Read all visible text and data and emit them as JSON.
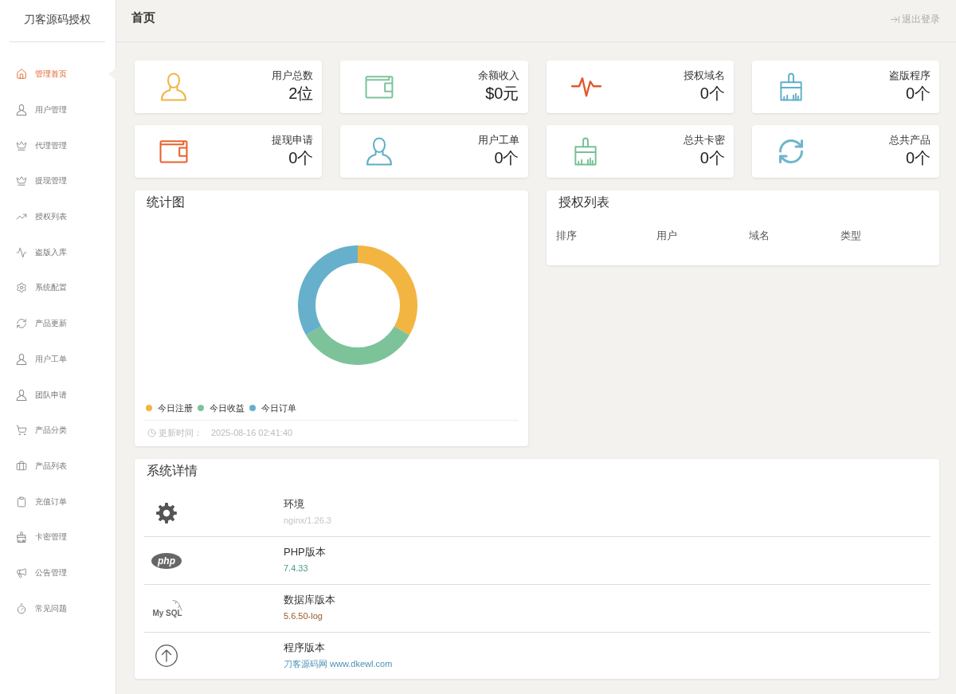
{
  "sidebar": {
    "brand": "刀客源码授权",
    "items": [
      {
        "label": "管理首页",
        "kind": "home",
        "selected": true
      },
      {
        "label": "用户管理",
        "kind": "user",
        "selected": false
      },
      {
        "label": "代理管理",
        "kind": "crown",
        "selected": false
      },
      {
        "label": "提现管理",
        "kind": "crown",
        "selected": false
      },
      {
        "label": "授权列表",
        "kind": "trend",
        "selected": false
      },
      {
        "label": "盗版入库",
        "kind": "pulse",
        "selected": false
      },
      {
        "label": "系统配置",
        "kind": "gear",
        "selected": false
      },
      {
        "label": "产品更新",
        "kind": "refresh",
        "selected": false
      },
      {
        "label": "用户工单",
        "kind": "user",
        "selected": false
      },
      {
        "label": "团队申请",
        "kind": "user",
        "selected": false
      },
      {
        "label": "产品分类",
        "kind": "cart",
        "selected": false
      },
      {
        "label": "产品列表",
        "kind": "bag",
        "selected": false
      },
      {
        "label": "充值订单",
        "kind": "clipboard",
        "selected": false
      },
      {
        "label": "卡密管理",
        "kind": "broom",
        "selected": false
      },
      {
        "label": "公告管理",
        "kind": "megaphone",
        "selected": false
      },
      {
        "label": "常见问题",
        "kind": "timer",
        "selected": false
      }
    ]
  },
  "header": {
    "title": "首页",
    "logout": "退出登录"
  },
  "stats": [
    {
      "label": "用户总数",
      "value": "2位",
      "kind": "user",
      "color": "#f0b43f"
    },
    {
      "label": "余额收入",
      "value": "$0元",
      "kind": "wallet",
      "color": "#7cc49b"
    },
    {
      "label": "授权域名",
      "value": "0个",
      "kind": "pulse",
      "color": "#e05a2b"
    },
    {
      "label": "盗版程序",
      "value": "0个",
      "kind": "broom",
      "color": "#5fb0c9"
    },
    {
      "label": "提现申请",
      "value": "0个",
      "kind": "wallet",
      "color": "#e8622c"
    },
    {
      "label": "用户工单",
      "value": "0个",
      "kind": "user",
      "color": "#5aaec6"
    },
    {
      "label": "总共卡密",
      "value": "0个",
      "kind": "broom",
      "color": "#76c196"
    },
    {
      "label": "总共产品",
      "value": "0个",
      "kind": "refresh",
      "color": "#6fb5cc"
    }
  ],
  "stats_chart": {
    "title": "统计图",
    "legend": [
      {
        "label": "今日注册",
        "color": "#f2b542"
      },
      {
        "label": "今日收益",
        "color": "#7cc39a"
      },
      {
        "label": "今日订单",
        "color": "#66b0cc"
      }
    ],
    "updated_label": "更新时间：",
    "updated_time": "2025-08-16 02:41:40"
  },
  "license_list": {
    "title": "授权列表",
    "columns": [
      "排序",
      "用户",
      "域名",
      "类型"
    ]
  },
  "system": {
    "title": "系统详情",
    "rows": [
      {
        "kind": "gear",
        "label": "环境",
        "value": "nginx/1.26.3",
        "color": "#c4c4c4"
      },
      {
        "kind": "php",
        "logo_text": "php",
        "label": "PHP版本",
        "value": "7.4.33",
        "color": "#4f9a8e"
      },
      {
        "kind": "mysql",
        "logo_text": "My SQL",
        "label": "数据库版本",
        "value": "5.6.50-log",
        "color": "#9a5a2a"
      },
      {
        "kind": "upgrade",
        "label": "程序版本",
        "value": "刀客源码网 www.dkewl.com",
        "color": "#4a90b8"
      }
    ]
  }
}
